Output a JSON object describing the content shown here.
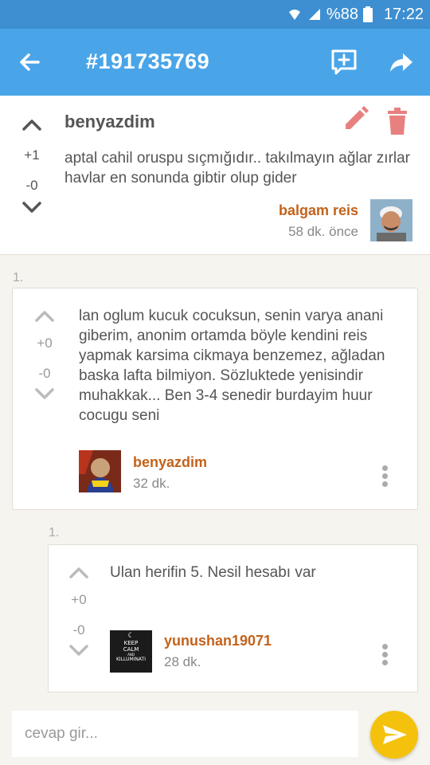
{
  "status_bar": {
    "battery_percent": "%88",
    "time": "17:22",
    "icons": [
      "wifi-icon",
      "signal-icon",
      "battery-icon"
    ]
  },
  "app_bar": {
    "title": "#191735769",
    "icons": [
      "back-arrow-icon",
      "add-comment-icon",
      "share-icon"
    ]
  },
  "entry": {
    "title": "benyazdim",
    "text": "aptal cahil oruspu sıçmığıdır.. takılmayın ağlar zırlar havlar en sonunda gibtir olup gider",
    "upvotes": "+1",
    "downvotes": "-0",
    "author": "balgam reis",
    "time": "58 dk. önce",
    "edit_icon": "pencil-icon",
    "delete_icon": "trash-icon",
    "accent_color": "#e88080"
  },
  "comments": [
    {
      "index": "1.",
      "text": "lan oglum kucuk cocuksun, senin varya anani giberim, anonim ortamda böyle kendini reis yapmak karsima cikmaya benzemez, ağladan baska lafta bilmiyon. Sözluktede yenisindir muhakkak... Ben 3-4 senedir burdayim huur cocugu seni",
      "upvotes": "+0",
      "downvotes": "-0",
      "author": "benyazdim",
      "time": "32 dk."
    },
    {
      "index": "1.",
      "text": "Ulan herifin 5. Nesil hesabı var",
      "upvotes": "+0",
      "downvotes": "-0",
      "author": "yunushan19071",
      "time": "28 dk.",
      "avatar_text": [
        "KEEP",
        "CALM",
        "AND",
        "KILLUMINATI"
      ]
    }
  ],
  "composer": {
    "placeholder": "cevap gir...",
    "send_icon": "send-icon"
  },
  "colors": {
    "status_bar": "#3d8fd1",
    "app_bar": "#4aa5e8",
    "author": "#c3621a",
    "send_button": "#f4c20d"
  }
}
